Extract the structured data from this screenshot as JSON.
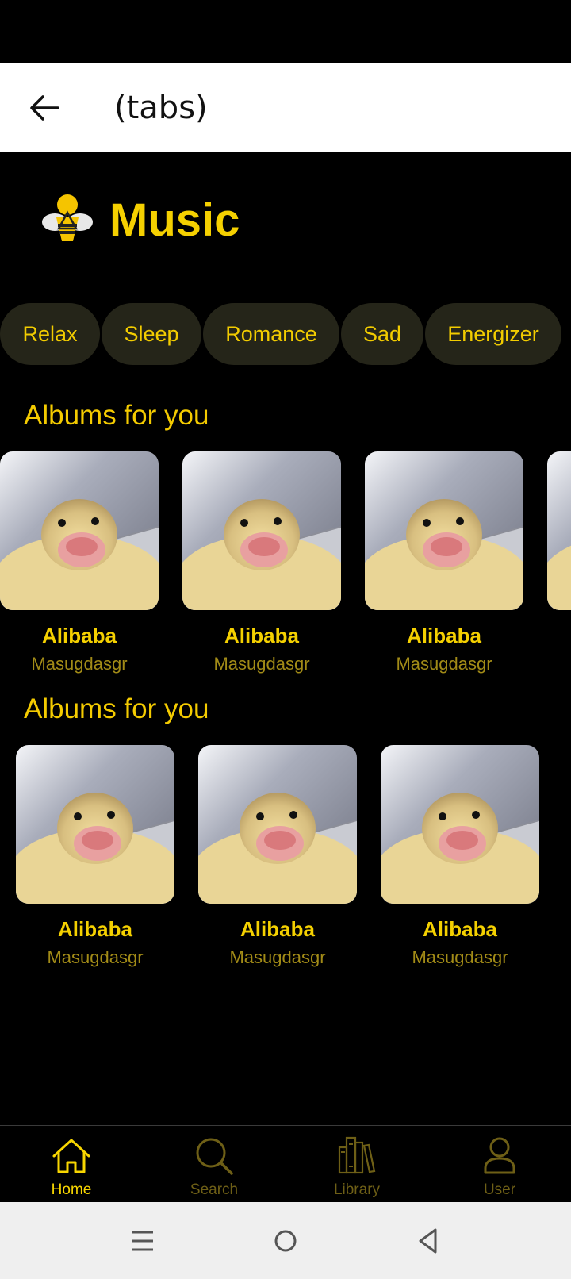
{
  "app_bar": {
    "title": "(tabs)"
  },
  "brand": {
    "title": "Music"
  },
  "moods": [
    "Relax",
    "Sleep",
    "Romance",
    "Sad",
    "Energizer"
  ],
  "sections": [
    {
      "title": "Albums for you",
      "albums": [
        {
          "name": "Alibaba",
          "artist": "Masugdasgr"
        },
        {
          "name": "Alibaba",
          "artist": "Masugdasgr"
        },
        {
          "name": "Alibaba",
          "artist": "Masugdasgr"
        },
        {
          "name": "",
          "artist": ""
        }
      ]
    },
    {
      "title": "Albums for you",
      "albums": [
        {
          "name": "Alibaba",
          "artist": "Masugdasgr"
        },
        {
          "name": "Alibaba",
          "artist": "Masugdasgr"
        },
        {
          "name": "Alibaba",
          "artist": "Masugdasgr"
        }
      ]
    }
  ],
  "bottom_nav": [
    {
      "label": "Home",
      "icon": "home-icon",
      "active": true
    },
    {
      "label": "Search",
      "icon": "search-icon",
      "active": false
    },
    {
      "label": "Library",
      "icon": "library-icon",
      "active": false
    },
    {
      "label": "User",
      "icon": "user-icon",
      "active": false
    }
  ],
  "colors": {
    "accent": "#f5d000",
    "chip_bg": "#252519",
    "artist_text": "#a28b17",
    "background": "#000000"
  }
}
